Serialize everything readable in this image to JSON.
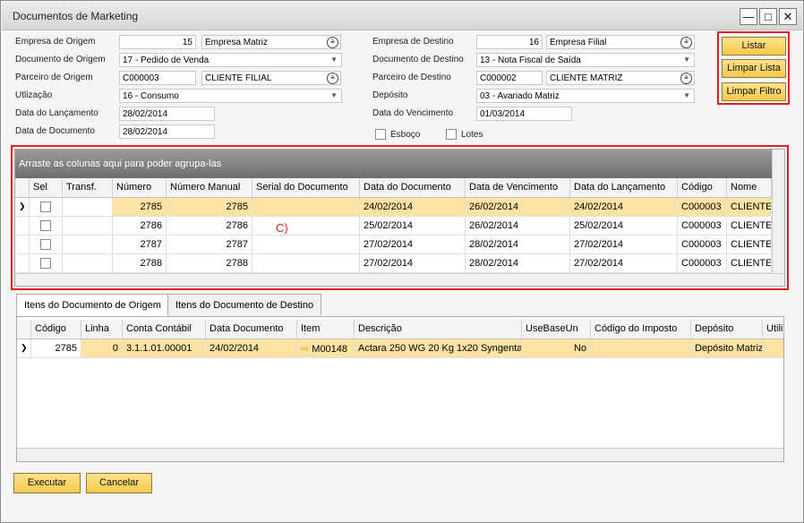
{
  "window": {
    "title": "Documentos de Marketing"
  },
  "header": {
    "empresa_origem": {
      "label": "Empresa de Origem",
      "code": "15",
      "name": "Empresa Matriz"
    },
    "documento_origem": {
      "label": "Documento de Origem",
      "value": "17       - Pedido de Venda"
    },
    "parceiro_origem": {
      "label": "Parceiro de Origem",
      "code": "C000003",
      "name": "CLIENTE FILIAL"
    },
    "utilizacao": {
      "label": "Utlização",
      "value": "16       - Consumo"
    },
    "data_lancamento": {
      "label": "Data do Lançamento",
      "value": "28/02/2014"
    },
    "data_documento": {
      "label": "Data de Documento",
      "value": "28/02/2014"
    },
    "empresa_destino": {
      "label": "Empresa de Destino",
      "code": "16",
      "name": "Empresa Filial"
    },
    "documento_destino": {
      "label": "Documento de Destino",
      "value": "13       - Nota Fiscal de Saída"
    },
    "parceiro_destino": {
      "label": "Parceiro de Destino",
      "code": "C000002",
      "name": "CLIENTE MATRIZ"
    },
    "deposito": {
      "label": "Depósito",
      "value": "03       - Avariado Matriz"
    },
    "data_vencimento": {
      "label": "Data do Vencimento",
      "value": "01/03/2014"
    },
    "esboco": {
      "label": "Esboço"
    },
    "lotes": {
      "label": "Lotes"
    }
  },
  "side_buttons": {
    "listar": "Listar",
    "limpar_lista": "Limpar Lista",
    "limpar_filtro": "Limpar Filtro"
  },
  "grid1": {
    "group_hint": "Arraste as colunas aqui para poder agrupa-las",
    "annotation": "C)",
    "columns": [
      "Sel",
      "Transf.",
      "Número",
      "Número Manual",
      "Serial do Documento",
      "Data do Documento",
      "Data de Vencimento",
      "Data do Lançamento",
      "Código",
      "Nome"
    ],
    "rows": [
      {
        "numero": "2785",
        "manual": "2785",
        "data_doc": "24/02/2014",
        "venc": "26/02/2014",
        "lanc": "24/02/2014",
        "codigo": "C000003",
        "nome": "CLIENTE F"
      },
      {
        "numero": "2786",
        "manual": "2786",
        "data_doc": "25/02/2014",
        "venc": "26/02/2014",
        "lanc": "25/02/2014",
        "codigo": "C000003",
        "nome": "CLIENTE F"
      },
      {
        "numero": "2787",
        "manual": "2787",
        "data_doc": "27/02/2014",
        "venc": "28/02/2014",
        "lanc": "27/02/2014",
        "codigo": "C000003",
        "nome": "CLIENTE F"
      },
      {
        "numero": "2788",
        "manual": "2788",
        "data_doc": "27/02/2014",
        "venc": "28/02/2014",
        "lanc": "27/02/2014",
        "codigo": "C000003",
        "nome": "CLIENTE F"
      }
    ]
  },
  "tabs": [
    "Itens do Documento de Origem",
    "Itens do Documento de Destino"
  ],
  "grid2": {
    "columns": [
      "Código",
      "Linha",
      "Conta Contábil",
      "Data Documento",
      "Item",
      "Descrição",
      "UseBaseUn",
      "Código do Imposto",
      "Depósito",
      "Utili"
    ],
    "row": {
      "codigo": "2785",
      "linha": "0",
      "conta": "3.1.1.01.00001",
      "data": "24/02/2014",
      "item": "M00148",
      "descricao": "Actara 250 WG 20 Kg 1x20 Syngenta",
      "usebase": "No",
      "imposto": "",
      "deposito": "Depósito Matriz"
    }
  },
  "footer": {
    "executar": "Executar",
    "cancelar": "Cancelar"
  },
  "colors": {
    "accent": "#f5c84a",
    "highlight": "#e02020"
  }
}
